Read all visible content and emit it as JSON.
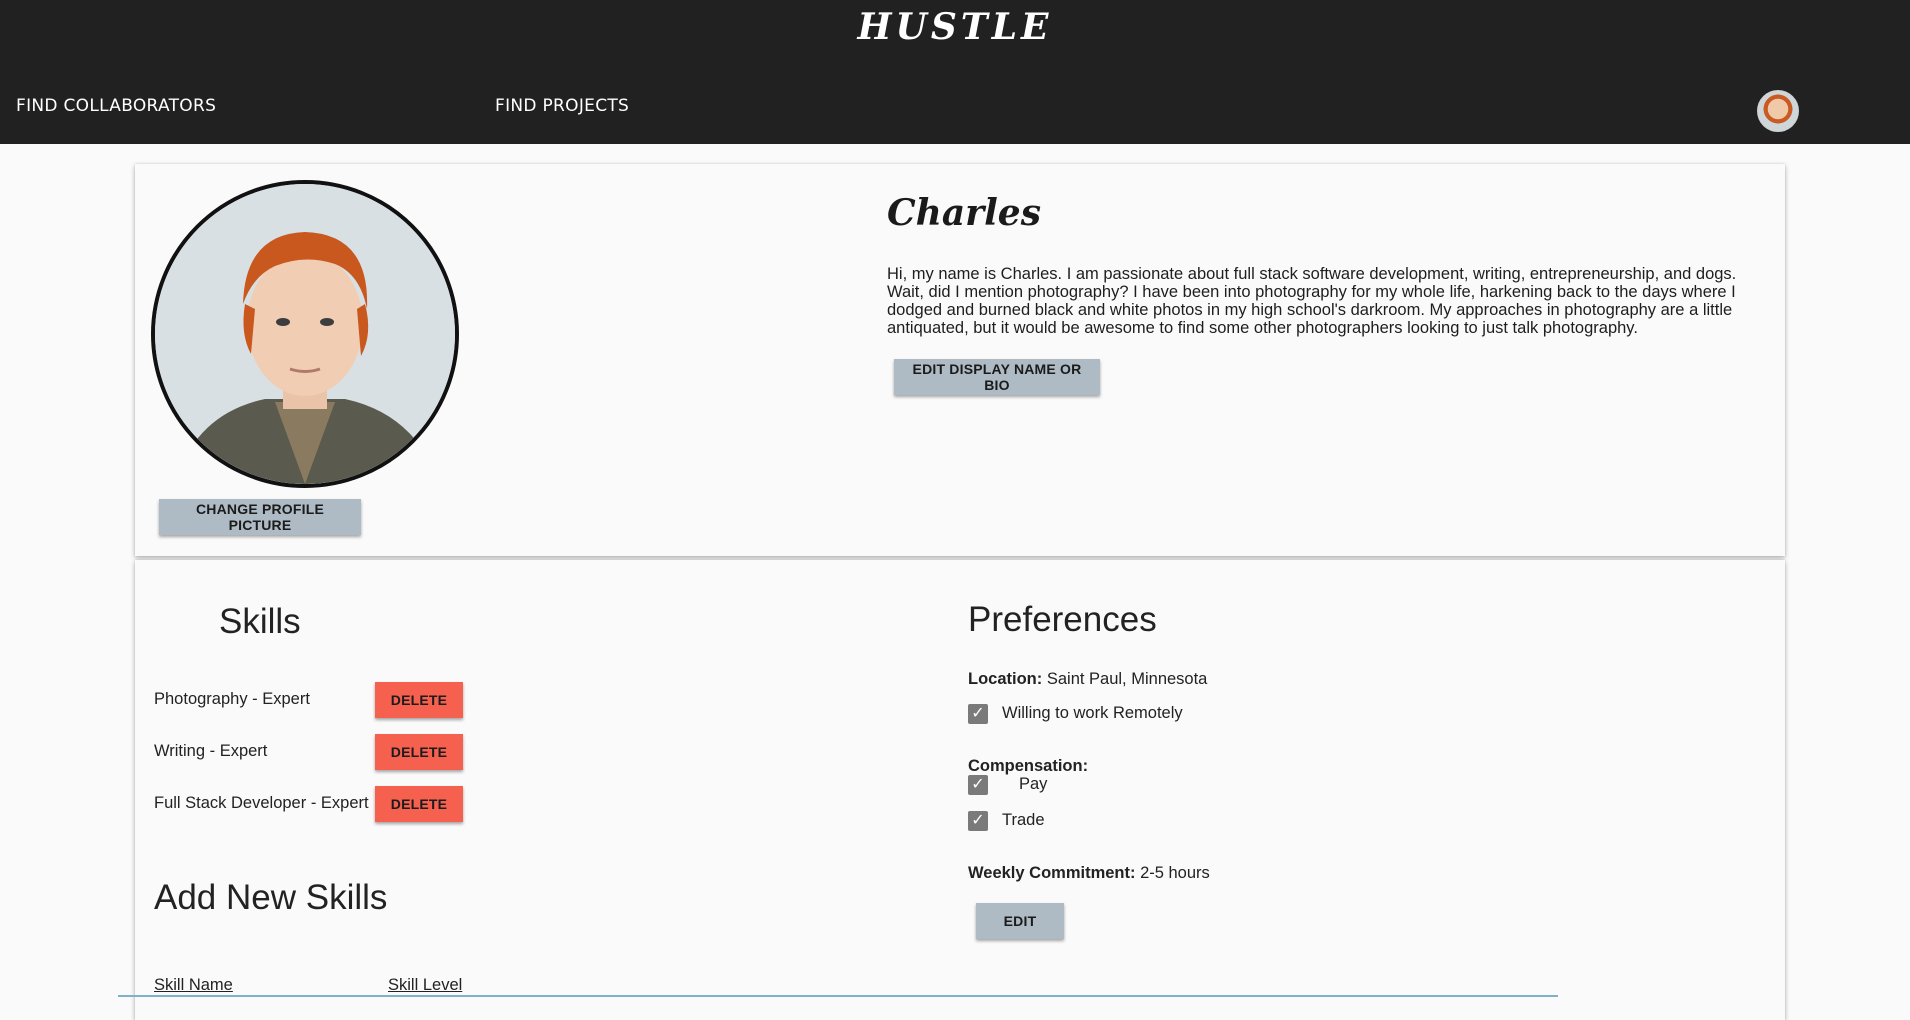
{
  "header": {
    "brand": "HUSTLE",
    "nav": {
      "find_collaborators": "FIND COLLABORATORS",
      "find_projects": "FIND PROJECTS"
    }
  },
  "profile": {
    "display_name": "Charles",
    "bio": "Hi, my name is Charles. I am passionate about full stack software development, writing, entrepreneurship, and dogs. Wait, did I mention photography? I have been into photography for my whole life, harkening back to the days where I dodged and burned black and white photos in my high school's darkroom. My approaches in photography are a little antiquated, but it would be awesome to find some other photographers looking to just talk photography.",
    "change_picture_label": "CHANGE PROFILE PICTURE",
    "edit_bio_label": "EDIT DISPLAY NAME OR BIO"
  },
  "skills": {
    "heading": "Skills",
    "items": [
      {
        "label": "Photography - Expert",
        "action": "DELETE"
      },
      {
        "label": "Writing - Expert",
        "action": "DELETE"
      },
      {
        "label": "Full Stack Developer - Expert",
        "action": "DELETE"
      }
    ],
    "add_heading": "Add New Skills",
    "columns": {
      "name": "Skill Name",
      "level": "Skill Level"
    }
  },
  "preferences": {
    "heading": "Preferences",
    "location_label": "Location:",
    "location_value": "Saint Paul, Minnesota",
    "remote_label": "Willing to work Remotely",
    "remote_checked": true,
    "compensation_label": "Compensation:",
    "pay_label": "Pay",
    "pay_checked": true,
    "trade_label": "Trade",
    "trade_checked": true,
    "commitment_label": "Weekly Commitment:",
    "commitment_value": "2-5 hours",
    "edit_label": "EDIT"
  },
  "colors": {
    "header_bg": "#212121",
    "grey_button": "#aebbc4",
    "delete_button": "#f5604f",
    "checkbox": "#7a7a7a"
  }
}
